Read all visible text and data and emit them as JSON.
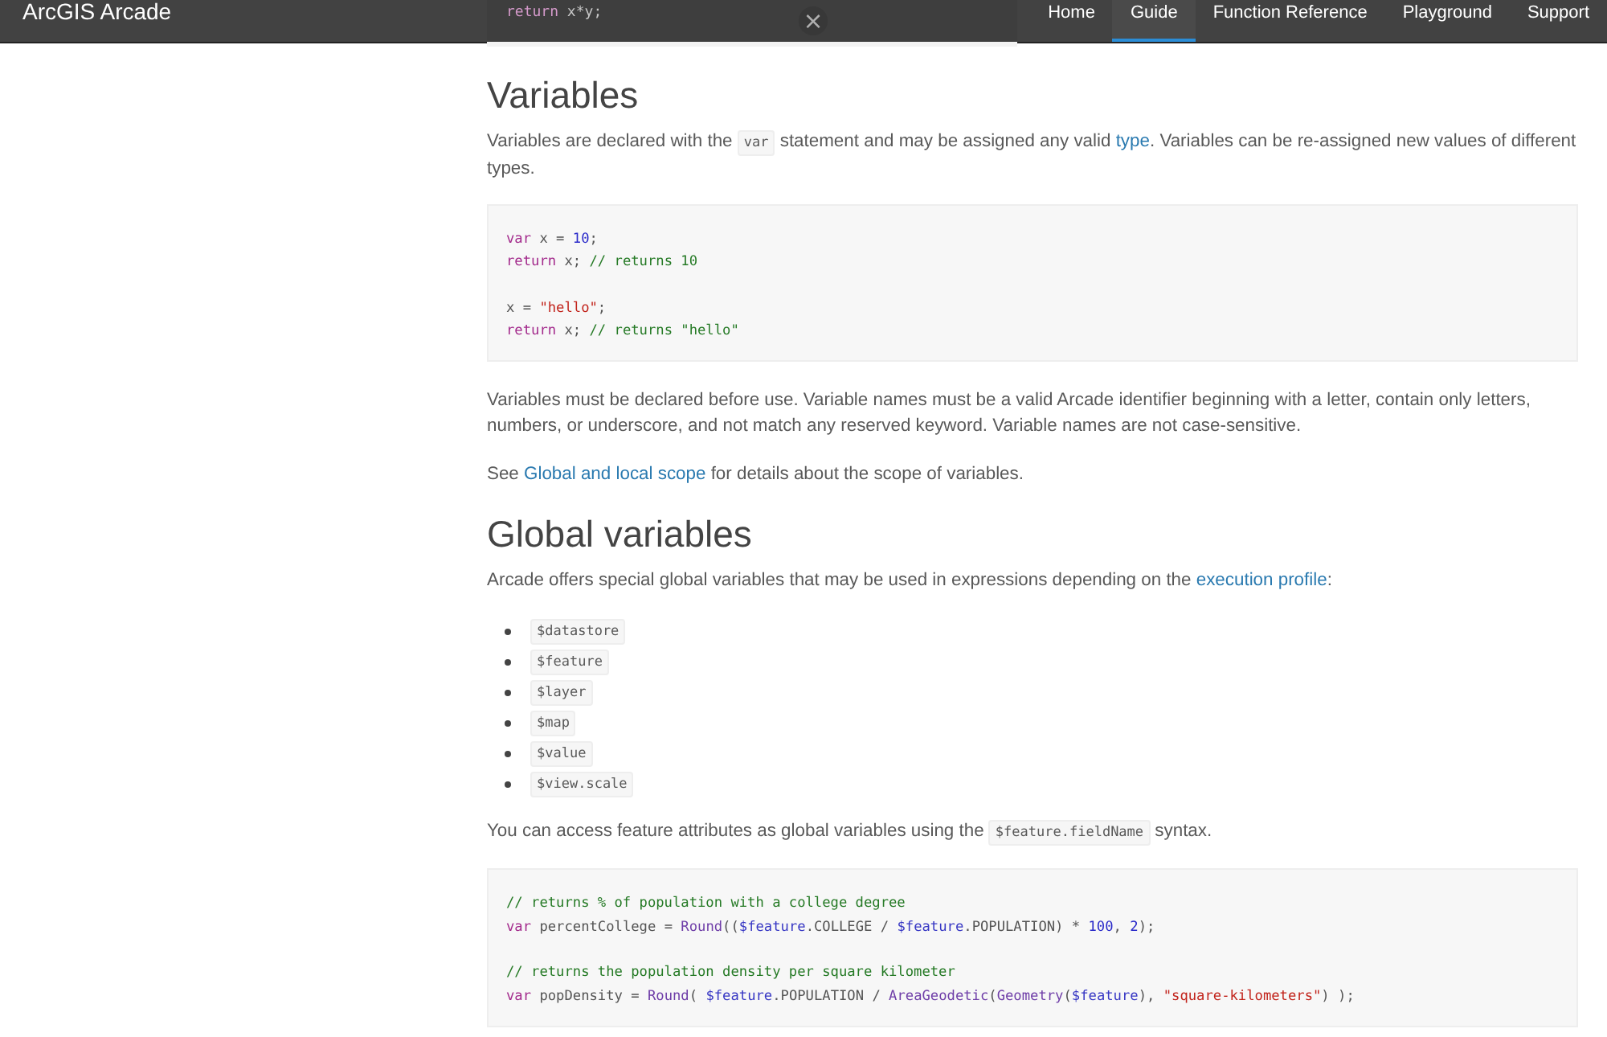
{
  "header": {
    "brand": "ArcGIS Arcade",
    "nav": [
      {
        "label": "Home",
        "selected": false
      },
      {
        "label": "Guide",
        "selected": true
      },
      {
        "label": "Function Reference",
        "selected": false
      },
      {
        "label": "Playground",
        "selected": false
      },
      {
        "label": "Support",
        "selected": false
      }
    ]
  },
  "previous_code": {
    "line": [
      {
        "kind": "kw",
        "t": "return"
      },
      {
        "kind": "plain",
        "t": " x*y;"
      }
    ],
    "close": "×"
  },
  "sections": [
    {
      "kind": "heading",
      "text": "Variables"
    },
    {
      "kind": "paragraph",
      "parts": [
        {
          "kind": "text",
          "t": "Variables are declared with the "
        },
        {
          "kind": "code",
          "t": "var"
        },
        {
          "kind": "text",
          "t": " statement and may be assigned any valid "
        },
        {
          "kind": "link",
          "t": "type"
        },
        {
          "kind": "text",
          "t": ". Variables can be re-assigned new values of different types."
        }
      ]
    },
    {
      "kind": "code",
      "groups": [
        [
          [
            {
              "kind": "kw",
              "t": "var"
            },
            {
              "kind": "plain",
              "t": " x = "
            },
            {
              "kind": "num",
              "t": "10"
            },
            {
              "kind": "plain",
              "t": ";"
            }
          ],
          [
            {
              "kind": "kw",
              "t": "return"
            },
            {
              "kind": "plain",
              "t": " x; "
            },
            {
              "kind": "comment",
              "t": "// returns 10"
            }
          ]
        ],
        [
          [
            {
              "kind": "plain",
              "t": "x = "
            },
            {
              "kind": "str",
              "t": "\"hello\""
            },
            {
              "kind": "plain",
              "t": ";"
            }
          ],
          [
            {
              "kind": "kw",
              "t": "return"
            },
            {
              "kind": "plain",
              "t": " x; "
            },
            {
              "kind": "comment",
              "t": "// returns \"hello\""
            }
          ]
        ]
      ]
    },
    {
      "kind": "paragraph",
      "parts": [
        {
          "kind": "text",
          "t": "Variables must be declared before use. Variable names must be a valid Arcade identifier beginning with a letter, contain only letters, numbers, or underscore, and not match any reserved keyword. Variable names are not case-sensitive."
        }
      ]
    },
    {
      "kind": "paragraph",
      "parts": [
        {
          "kind": "text",
          "t": "See "
        },
        {
          "kind": "link",
          "t": "Global and local scope"
        },
        {
          "kind": "text",
          "t": " for details about the scope of variables."
        }
      ]
    },
    {
      "kind": "heading",
      "text": "Global variables"
    },
    {
      "kind": "paragraph",
      "parts": [
        {
          "kind": "text",
          "t": "Arcade offers special global variables that may be used in expressions depending on the "
        },
        {
          "kind": "link",
          "t": "execution profile"
        },
        {
          "kind": "text",
          "t": ":"
        }
      ]
    },
    {
      "kind": "list",
      "items": [
        "$datastore",
        "$feature",
        "$layer",
        "$map",
        "$value",
        "$view.scale"
      ]
    },
    {
      "kind": "paragraph",
      "parts": [
        {
          "kind": "text",
          "t": "You can access feature attributes as global variables using the "
        },
        {
          "kind": "code",
          "t": "$feature.fieldName"
        },
        {
          "kind": "text",
          "t": " syntax."
        }
      ]
    },
    {
      "kind": "code",
      "groups": [
        [
          [
            {
              "kind": "comment",
              "t": "// returns % of population with a college degree"
            }
          ],
          [
            {
              "kind": "kw",
              "t": "var"
            },
            {
              "kind": "plain",
              "t": " percentCollege = "
            },
            {
              "kind": "func",
              "t": "Round"
            },
            {
              "kind": "plain",
              "t": "(("
            },
            {
              "kind": "var",
              "t": "$feature"
            },
            {
              "kind": "plain",
              "t": ".COLLEGE / "
            },
            {
              "kind": "var",
              "t": "$feature"
            },
            {
              "kind": "plain",
              "t": ".POPULATION) * "
            },
            {
              "kind": "num",
              "t": "100"
            },
            {
              "kind": "plain",
              "t": ", "
            },
            {
              "kind": "num",
              "t": "2"
            },
            {
              "kind": "plain",
              "t": ");"
            }
          ]
        ],
        [
          [
            {
              "kind": "comment",
              "t": "// returns the population density per square kilometer"
            }
          ],
          [
            {
              "kind": "kw",
              "t": "var"
            },
            {
              "kind": "plain",
              "t": " popDensity = "
            },
            {
              "kind": "func",
              "t": "Round"
            },
            {
              "kind": "plain",
              "t": "( "
            },
            {
              "kind": "var",
              "t": "$feature"
            },
            {
              "kind": "plain",
              "t": ".POPULATION / "
            },
            {
              "kind": "func",
              "t": "AreaGeodetic"
            },
            {
              "kind": "plain",
              "t": "("
            },
            {
              "kind": "func",
              "t": "Geometry"
            },
            {
              "kind": "plain",
              "t": "("
            },
            {
              "kind": "var",
              "t": "$feature"
            },
            {
              "kind": "plain",
              "t": "), "
            },
            {
              "kind": "str",
              "t": "\"square-kilometers\""
            },
            {
              "kind": "plain",
              "t": ") );"
            }
          ]
        ]
      ]
    }
  ]
}
